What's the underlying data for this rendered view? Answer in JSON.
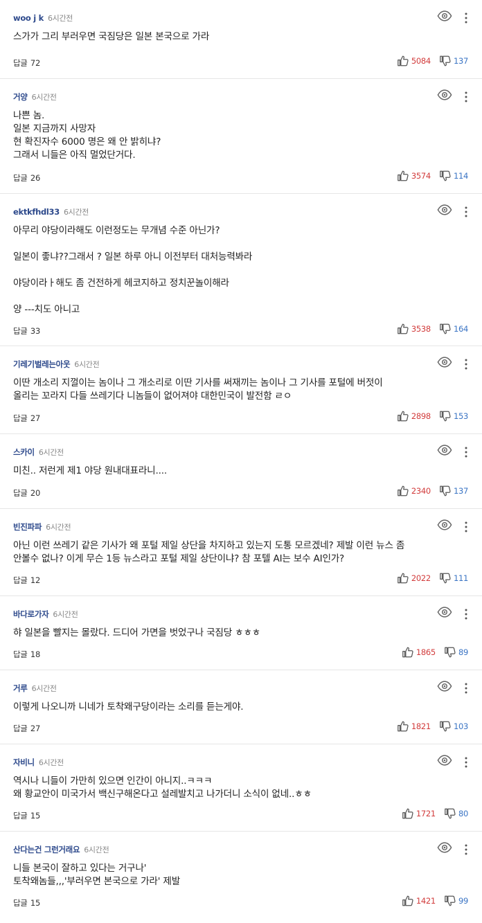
{
  "reply_label": "답글",
  "comments": [
    {
      "author": "woo j k",
      "time": "6시간전",
      "lines": [
        "스가가 그리 부러우면 국짐당은 일본 본국으로 가라"
      ],
      "replies": "72",
      "likes": "5084",
      "dislikes": "137"
    },
    {
      "author": "거양",
      "time": "6시간전",
      "lines": [
        "나쁜 놈.",
        "일본 지금까지 사망자",
        "현 확진자수 6000 명은 왜 안 밝히냐?",
        "그래서 니들은 아직 멀었단거다."
      ],
      "replies": "26",
      "likes": "3574",
      "dislikes": "114"
    },
    {
      "author": "ektkfhdl33",
      "time": "6시간전",
      "lines": [
        "아무리 야당이라해도 이런정도는 무개념 수준 아닌가?",
        "",
        "일본이 좋냐??그래서 ? 일본 하루 아니 이전부터 대처능력봐라",
        "",
        "야당이라ㅏ해도 좀 건전하게 헤코지하고 정치꾼놀이해라",
        "",
        "양 ---치도 아니고"
      ],
      "replies": "33",
      "likes": "3538",
      "dislikes": "164"
    },
    {
      "author": "기레기벌레는아웃",
      "time": "6시간전",
      "lines": [
        "이딴 개소리 지껄이는 놈이나 그 개소리로 이딴 기사를 써재끼는 놈이나 그 기사를 포털에 버젓이",
        "올리는 꼬라지 다들 쓰레기다 니놈들이 없어져야 대한민국이 발전함 ㄹㅇ"
      ],
      "replies": "27",
      "likes": "2898",
      "dislikes": "153"
    },
    {
      "author": "스카이",
      "time": "6시간전",
      "lines": [
        "미친.. 저런게 제1 야당 원내대표라니...."
      ],
      "replies": "20",
      "likes": "2340",
      "dislikes": "137"
    },
    {
      "author": "빈진파파",
      "time": "6시간전",
      "lines": [
        "아닌 이런 쓰레기 같은 기사가 왜 포털 제일 상단을 차지하고 있는지 도통 모르겠네? 제발 이런 뉴스 좀",
        "안볼수 없나? 이게 무슨 1등 뉴스라고 포털 제일 상단이냐? 참 포텔 AI는 보수 AI인가?"
      ],
      "replies": "12",
      "likes": "2022",
      "dislikes": "111"
    },
    {
      "author": "바다로가자",
      "time": "6시간전",
      "lines": [
        "햐 일본을 빨지는 몰랐다. 드디어 가면을 벗었구나 국짐당 ㅎㅎㅎ"
      ],
      "replies": "18",
      "likes": "1865",
      "dislikes": "89"
    },
    {
      "author": "거루",
      "time": "6시간전",
      "lines": [
        "이렇게 나오니까 니네가 토착왜구당이라는 소리를 듣는게야."
      ],
      "replies": "27",
      "likes": "1821",
      "dislikes": "103"
    },
    {
      "author": "자비니",
      "time": "6시간전",
      "lines": [
        "역시나 니들이 가만히 있으면 인간이 아니지..ㅋㅋㅋ",
        "왜 황교안이 미국가서 백신구해온다고 설레발치고 나가더니 소식이 없네..ㅎㅎ"
      ],
      "replies": "15",
      "likes": "1721",
      "dislikes": "80"
    },
    {
      "author": "산다는건 그런거래요",
      "time": "6시간전",
      "lines": [
        "니들 본국이 잘하고 있다는 거구나'",
        "토착왜놈들,,,'부러우면 본국으로 가라' 제발"
      ],
      "replies": "15",
      "likes": "1421",
      "dislikes": "99"
    }
  ]
}
